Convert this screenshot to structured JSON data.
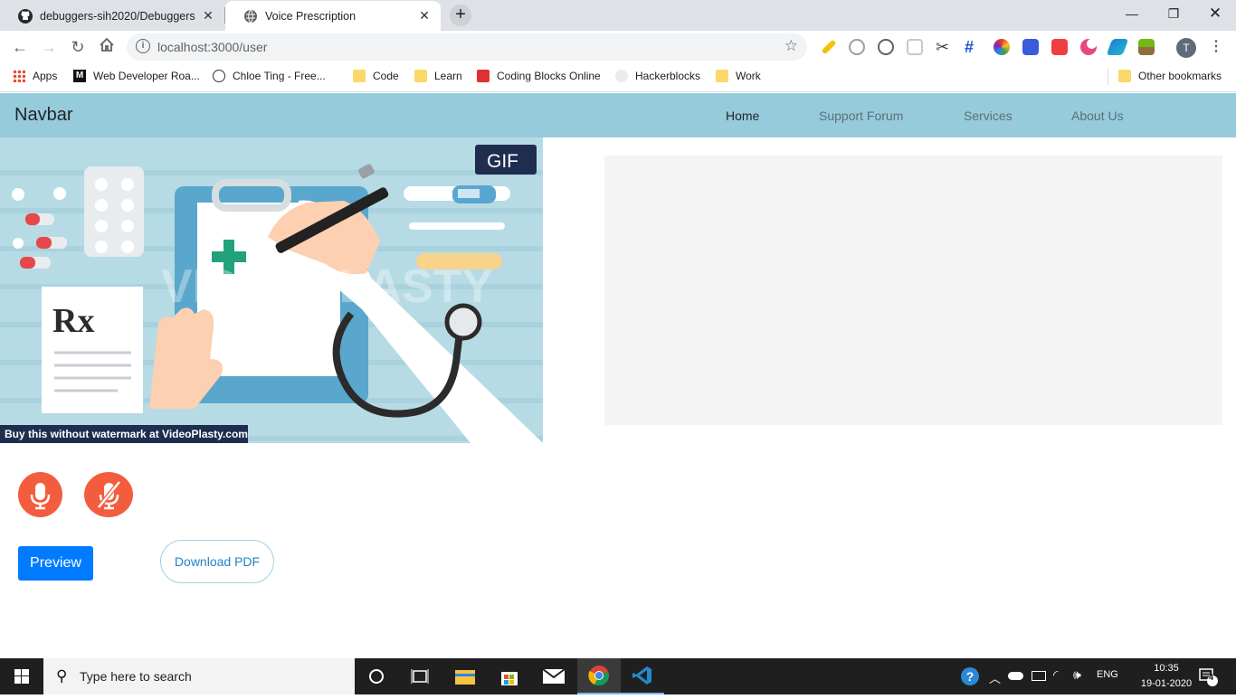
{
  "browser": {
    "tabs": [
      {
        "title": "debuggers-sih2020/Debuggers",
        "icon": "github-icon"
      },
      {
        "title": "Voice Prescription",
        "icon": "globe-icon"
      }
    ],
    "url": "localhost:3000/user",
    "profile_initial": "T",
    "bookmarks": [
      "Apps",
      "Web Developer Roa...",
      "Chloe Ting - Free...",
      "Code",
      "Learn",
      "Coding Blocks Online",
      "Hackerblocks",
      "Work"
    ],
    "other_bookmarks": "Other bookmarks"
  },
  "navbar": {
    "brand": "Navbar",
    "links": [
      "Home",
      "Support Forum",
      "Services",
      "About Us"
    ],
    "active_link": "Home"
  },
  "gif": {
    "badge": "GIF",
    "watermark": "VIDEOPLASTY",
    "rx": "Rx",
    "footer": "Buy this without watermark at VideoPlasty.com"
  },
  "actions": {
    "preview": "Preview",
    "download": "Download PDF"
  },
  "taskbar": {
    "search_placeholder": "Type here to search",
    "language": "ENG",
    "time": "10:35",
    "date": "19-01-2020",
    "notifications": "4"
  },
  "colors": {
    "navbar": "#96cbdc",
    "mic": "#f35d3e",
    "primary": "#007bff"
  }
}
